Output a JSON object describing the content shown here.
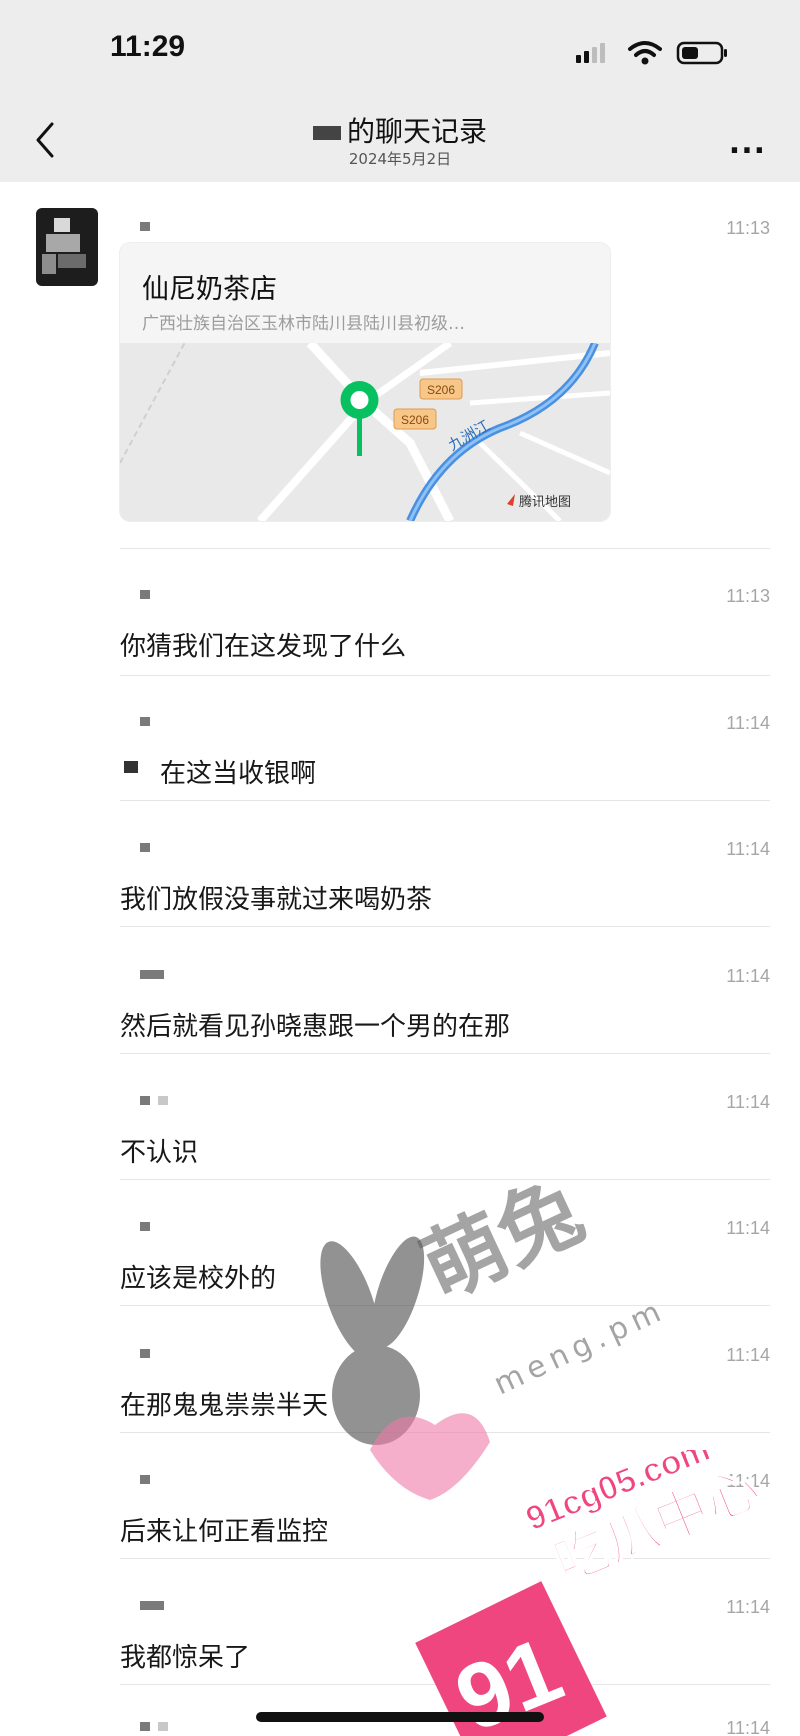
{
  "status_bar": {
    "time": "11:29"
  },
  "nav": {
    "title": "的聊天记录",
    "date": "2024年5月2日",
    "more": "..."
  },
  "messages": [
    {
      "time": "11:13",
      "type": "location"
    },
    {
      "time": "11:13",
      "text": "你猜我们在这发现了什么"
    },
    {
      "time": "11:14",
      "text": "在这当收银啊"
    },
    {
      "time": "11:14",
      "text": "我们放假没事就过来喝奶茶"
    },
    {
      "time": "11:14",
      "text": "然后就看见孙晓惠跟一个男的在那"
    },
    {
      "time": "11:14",
      "text": "不认识"
    },
    {
      "time": "11:14",
      "text": "应该是校外的"
    },
    {
      "time": "11:14",
      "text": "在那鬼鬼祟祟半天"
    },
    {
      "time": "11:14",
      "text": "后来让何正看监控"
    },
    {
      "time": "11:14",
      "text": "我都惊呆了"
    },
    {
      "time": "11:14",
      "text": ""
    }
  ],
  "location": {
    "name": "仙尼奶茶店",
    "address": "广西壮族自治区玉林市陆川县陆川县初级…",
    "road_label_1": "S206",
    "road_label_2": "S206",
    "river_label": "九洲江",
    "map_provider": "腾讯地图"
  },
  "watermarks": {
    "brand_cn": "萌兔",
    "brand_url": "meng.pm",
    "site_url": "91cg05.com",
    "site_name": "吃瓜中心",
    "site_number": "91"
  },
  "colors": {
    "background": "#ffffff",
    "bar": "#ededed",
    "pin": "#07c160",
    "timestamp": "#a6a6a6",
    "watermark_pink": "#f0467f"
  }
}
